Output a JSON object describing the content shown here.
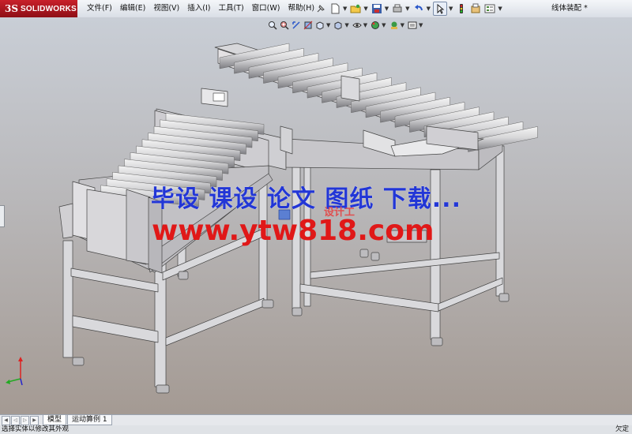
{
  "app": {
    "logo_ds": "3S",
    "logo_word": "SOLIDWORKS"
  },
  "menus": [
    "文件(F)",
    "编辑(E)",
    "视图(V)",
    "插入(I)",
    "工具(T)",
    "窗口(W)",
    "帮助(H)"
  ],
  "document": {
    "title": "线体装配 *"
  },
  "toolbar_icons": [
    "pin-icon",
    "new-file-icon",
    "open-folder-icon",
    "save-icon",
    "print-icon",
    "undo-icon",
    "select-pointer-icon",
    "traffic-light-icon",
    "file-properties-icon",
    "options-icon"
  ],
  "hud_icons": [
    "zoom-to-fit-icon",
    "zoom-area-icon",
    "previous-view-icon",
    "section-view-icon",
    "view-orientation-icon",
    "display-style-icon",
    "hide-show-icon",
    "edit-appearance-icon",
    "apply-scene-icon",
    "view-settings-icon"
  ],
  "watermark": {
    "line1": "毕设 课设 论文 图纸 下载...",
    "line2": "www.ytw818.com"
  },
  "model_labels": {
    "small_logo": "设计工"
  },
  "tabs": [
    {
      "label": "模型",
      "active": true
    },
    {
      "label": "运动算例 1",
      "active": false
    }
  ],
  "statusbar": {
    "message": "选择实体以修改其外观",
    "right": "欠定"
  },
  "colors": {
    "logo_red": "#c8202a",
    "watermark_blue": "#2236d6",
    "watermark_red": "#e01818",
    "frame": "#dcdcdc"
  }
}
